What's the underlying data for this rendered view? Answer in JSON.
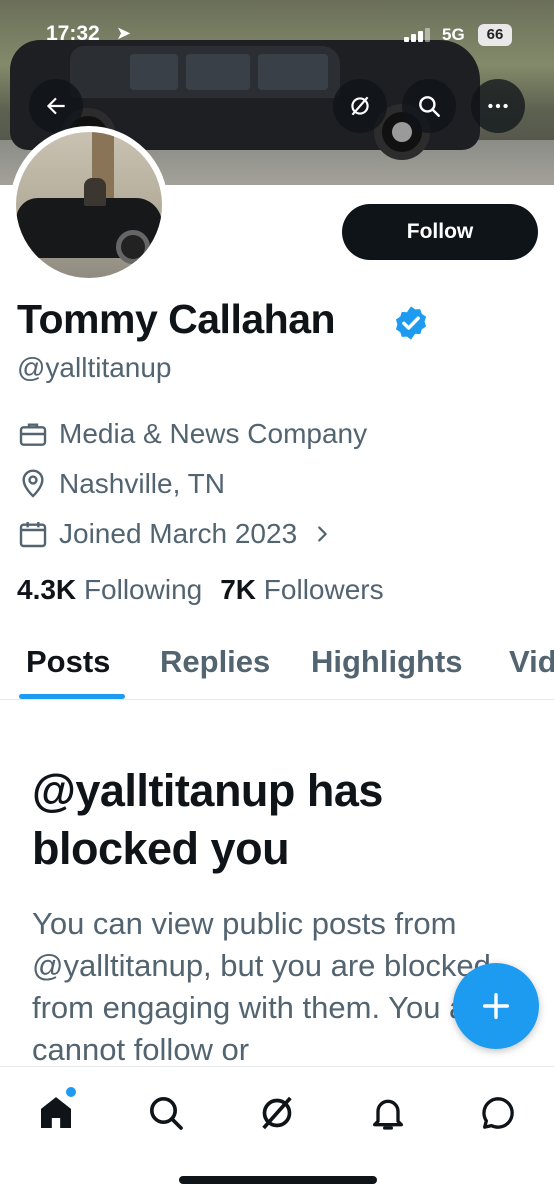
{
  "status_bar": {
    "time": "17:32",
    "location_glyph": "➤",
    "network": "5G",
    "battery": "66"
  },
  "header": {
    "back_icon": "back-arrow-icon",
    "grok_icon": "grok-icon",
    "search_icon": "search-icon",
    "more_icon": "more-icon"
  },
  "profile": {
    "name": "Tommy Callahan",
    "handle": "@yalltitanup",
    "verified": true,
    "follow_label": "Follow",
    "category": "Media & News Company",
    "location": "Nashville, TN",
    "joined": "Joined March 2023",
    "following_count": "4.3K",
    "following_label": "Following",
    "followers_count": "7K",
    "followers_label": "Followers"
  },
  "tabs": [
    {
      "label": "Posts",
      "active": true
    },
    {
      "label": "Replies",
      "active": false
    },
    {
      "label": "Highlights",
      "active": false
    },
    {
      "label": "Vid",
      "active": false
    }
  ],
  "blocked": {
    "title": "@yalltitanup has blocked you",
    "body": "You can view public posts from @yalltitanup, but you are blocked from engaging with them. You also cannot follow or"
  },
  "fab_icon": "plus-icon",
  "bottom_nav": [
    {
      "icon": "home-icon",
      "badge": true
    },
    {
      "icon": "search-icon",
      "badge": false
    },
    {
      "icon": "grok-icon",
      "badge": false
    },
    {
      "icon": "bell-icon",
      "badge": false
    },
    {
      "icon": "messages-icon",
      "badge": false
    }
  ],
  "colors": {
    "accent": "#1d9bf0",
    "text_primary": "#0f1419",
    "text_secondary": "#536471"
  }
}
